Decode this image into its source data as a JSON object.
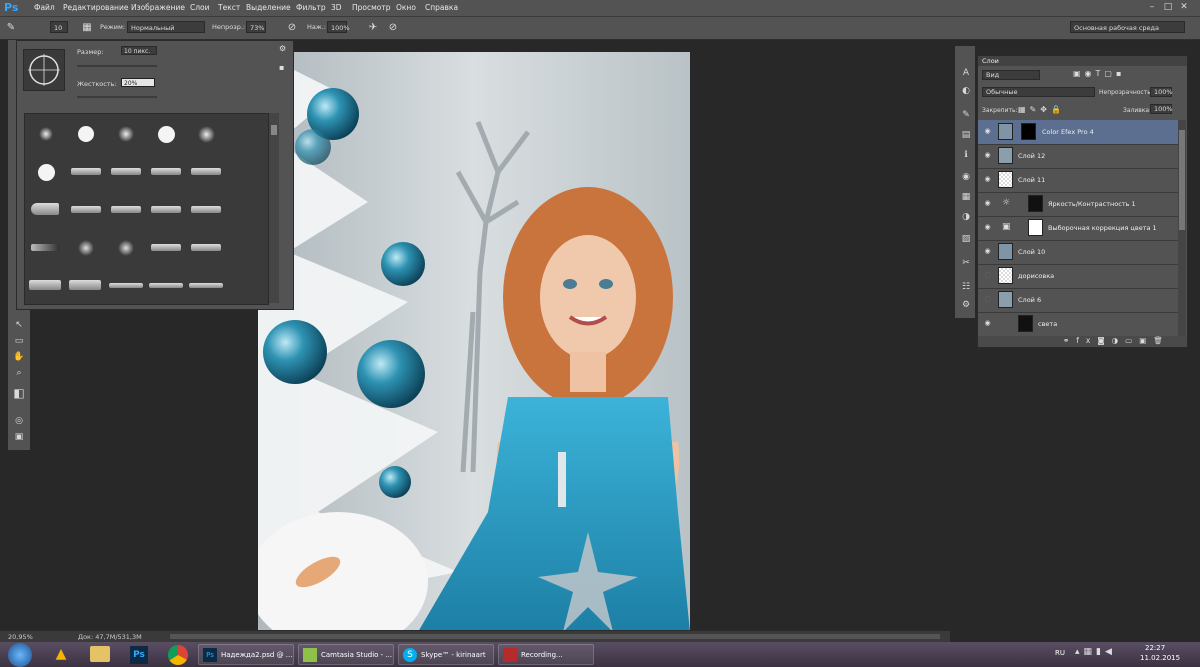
{
  "app": {
    "logo": "Ps"
  },
  "menu": [
    "Файл",
    "Редактирование",
    "Изображение",
    "Слои",
    "Текст",
    "Выделение",
    "Фильтр",
    "3D",
    "Просмотр",
    "Окно",
    "Справка"
  ],
  "options_bar": {
    "brush_size": "10",
    "mode_label": "Режим:",
    "mode_value": "Нормальный",
    "opacity_label": "Непрозр.:",
    "opacity_value": "73%",
    "flow_label": "Наж.:",
    "flow_value": "100%",
    "workspace": "Основная рабочая среда"
  },
  "brush_panel": {
    "size_label": "Размер:",
    "size_value": "10 пикс.",
    "hardness_label": "Жесткость:",
    "hardness_value": "20%"
  },
  "status": {
    "zoom": "20,95%",
    "doc": "Док: 47,7M/531,3M"
  },
  "layers_panel": {
    "title": "Слои",
    "filter_kind": "Вид",
    "blend_mode": "Обычные",
    "opacity_label": "Непрозрачность:",
    "opacity_value": "100%",
    "lock_label": "Закрепить:",
    "fill_label": "Заливка:",
    "fill_value": "100%",
    "layers": [
      {
        "name": "Color Efex Pro 4",
        "selected": true
      },
      {
        "name": "Слой 12",
        "selected": false
      },
      {
        "name": "Слой 11",
        "selected": false
      },
      {
        "name": "Яркость/Контрастность 1",
        "selected": false
      },
      {
        "name": "Выборочная коррекция цвета 1",
        "selected": false
      },
      {
        "name": "Слой 10",
        "selected": false
      },
      {
        "name": "дорисовка",
        "selected": false
      },
      {
        "name": "Слой 6",
        "selected": false
      },
      {
        "name": "света",
        "selected": false
      }
    ]
  },
  "taskbar": {
    "items": [
      "Надежда2.psd @ ...",
      "Camtasia Studio - ...",
      "Skype™ - kirinaart",
      "Recording..."
    ],
    "lang": "RU",
    "time": "22:27",
    "date": "11.02.2015"
  },
  "colors": {
    "ui_panel": "#535353",
    "ui_dark": "#282828",
    "selection": "#5d6f91",
    "accent": "#31a8ff"
  }
}
